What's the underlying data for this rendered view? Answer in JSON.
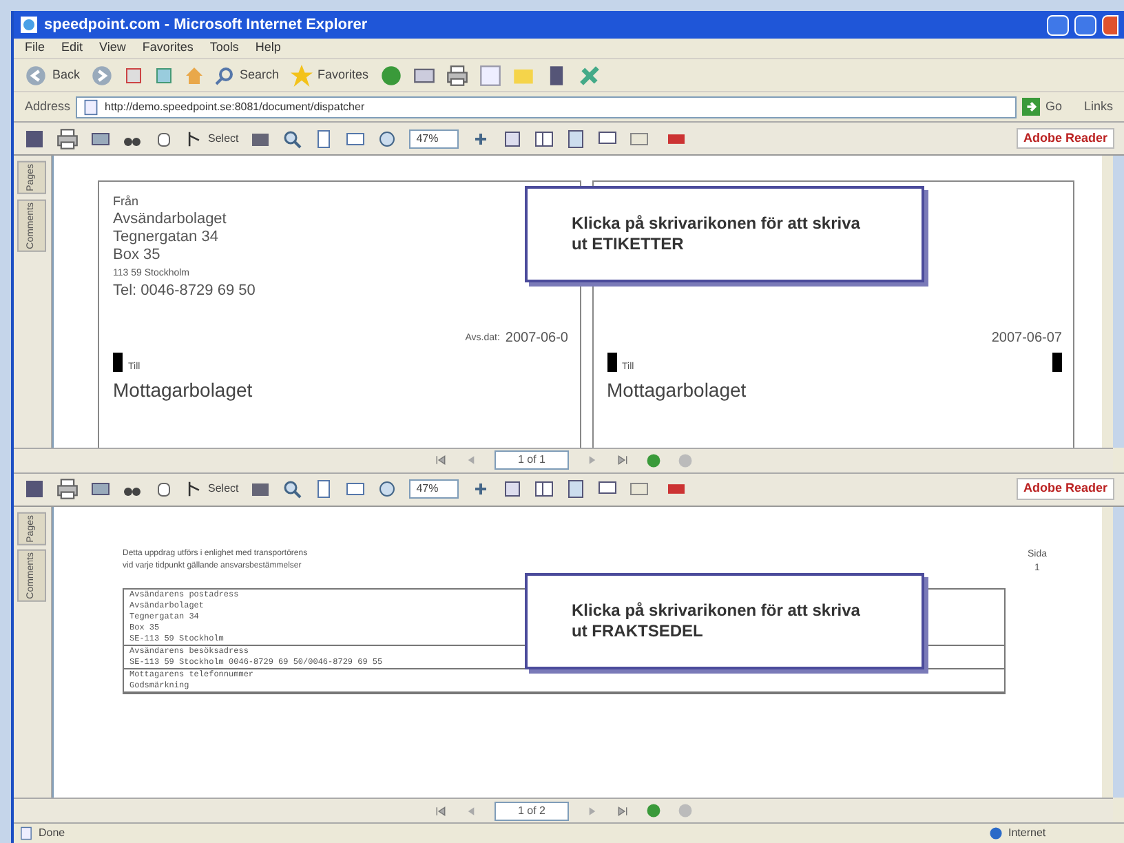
{
  "window": {
    "title": "speedpoint.com - Microsoft Internet Explorer"
  },
  "menu": [
    "File",
    "Edit",
    "View",
    "Favorites",
    "Tools",
    "Help"
  ],
  "toolbar": {
    "back": "Back",
    "search": "Search",
    "favorites": "Favorites"
  },
  "address": {
    "label": "Address",
    "url": "http://demo.speedpoint.se:8081/document/dispatcher",
    "go": "Go",
    "links": "Links"
  },
  "viewers": [
    {
      "kind": "labels",
      "toolbar": {
        "select": "Select",
        "zoom": "47%",
        "brand": "Adobe Reader"
      },
      "side_tabs": [
        "Pages",
        "Comments"
      ],
      "labels": [
        {
          "from": "Från",
          "lines": [
            "Avsändarbolaget",
            "Tegnergatan 34",
            "Box 35",
            "113 59 Stockholm",
            "Tel: 0046-8729 69 50"
          ],
          "date_label": "Avs.dat:",
          "date": "2007-06-0",
          "to": "Till",
          "recipient": "Mottagarbolaget"
        },
        {
          "date": "2007-06-07",
          "to": "Till",
          "recipient": "Mottagarbolaget"
        }
      ],
      "callout": "Klicka på skrivarikonen för att skriva ut ETIKETTER",
      "page_nav": "1 of 1"
    },
    {
      "kind": "waybill",
      "toolbar": {
        "select": "Select",
        "zoom": "47%",
        "brand": "Adobe Reader"
      },
      "side_tabs": [
        "Pages",
        "Comments"
      ],
      "notes": [
        "Detta uppdrag utförs i enlighet med transportörens",
        "vid varje tidpunkt gällande ansvarsbestämmelser"
      ],
      "page_label": "Sida",
      "page_number": "1",
      "rows": [
        [
          "Avsändarens postadress",
          "Avsändarbolaget",
          "Tegnergatan 34",
          "Box 35",
          "SE-113 59   Stockholm"
        ],
        [
          "Avsändarens besöksadress",
          "SE-113 59 Stockholm   0046-8729 69 50/0046-8729 69 55"
        ],
        [
          "Mottagarens telefonnummer",
          "Godsmärkning"
        ]
      ],
      "callout": "Klicka på skrivarikonen för att skriva ut FRAKTSEDEL",
      "page_nav": "1 of 2"
    }
  ],
  "status_bar": {
    "text": "Done",
    "zone": "Internet"
  }
}
